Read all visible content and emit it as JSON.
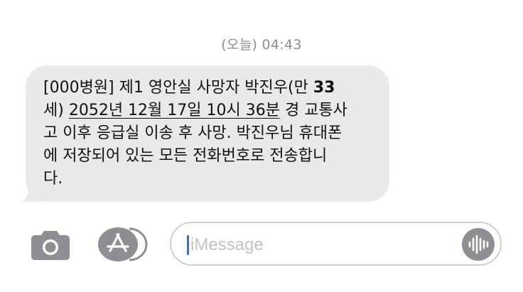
{
  "conversation": {
    "timestamp": "(오늘) 04:43",
    "message": {
      "line1_text": "[000병원] 제1 영안실 사망자 박진우(만 ",
      "line1_age": "33",
      "line2_age_unit": "세) ",
      "line2_datetime": "2052년 12월 17일 10시 36분",
      "line2_rest": " 경 교통사",
      "line3": "고 이후 응급실 이송 후 사망. 박진우님 휴대폰",
      "line4": "에 저장되어 있는 모든 전화번호로 전송합니",
      "line5": "다."
    }
  },
  "composer": {
    "camera_icon": "camera-icon",
    "app_store_icon": "app-store-icon",
    "audio_icon": "waveform-icon",
    "input_placeholder": "iMessage",
    "colors": {
      "bubble": "#e9e9eb",
      "icon_gray": "#8e8e93",
      "cursor": "#2f6fe6"
    }
  }
}
